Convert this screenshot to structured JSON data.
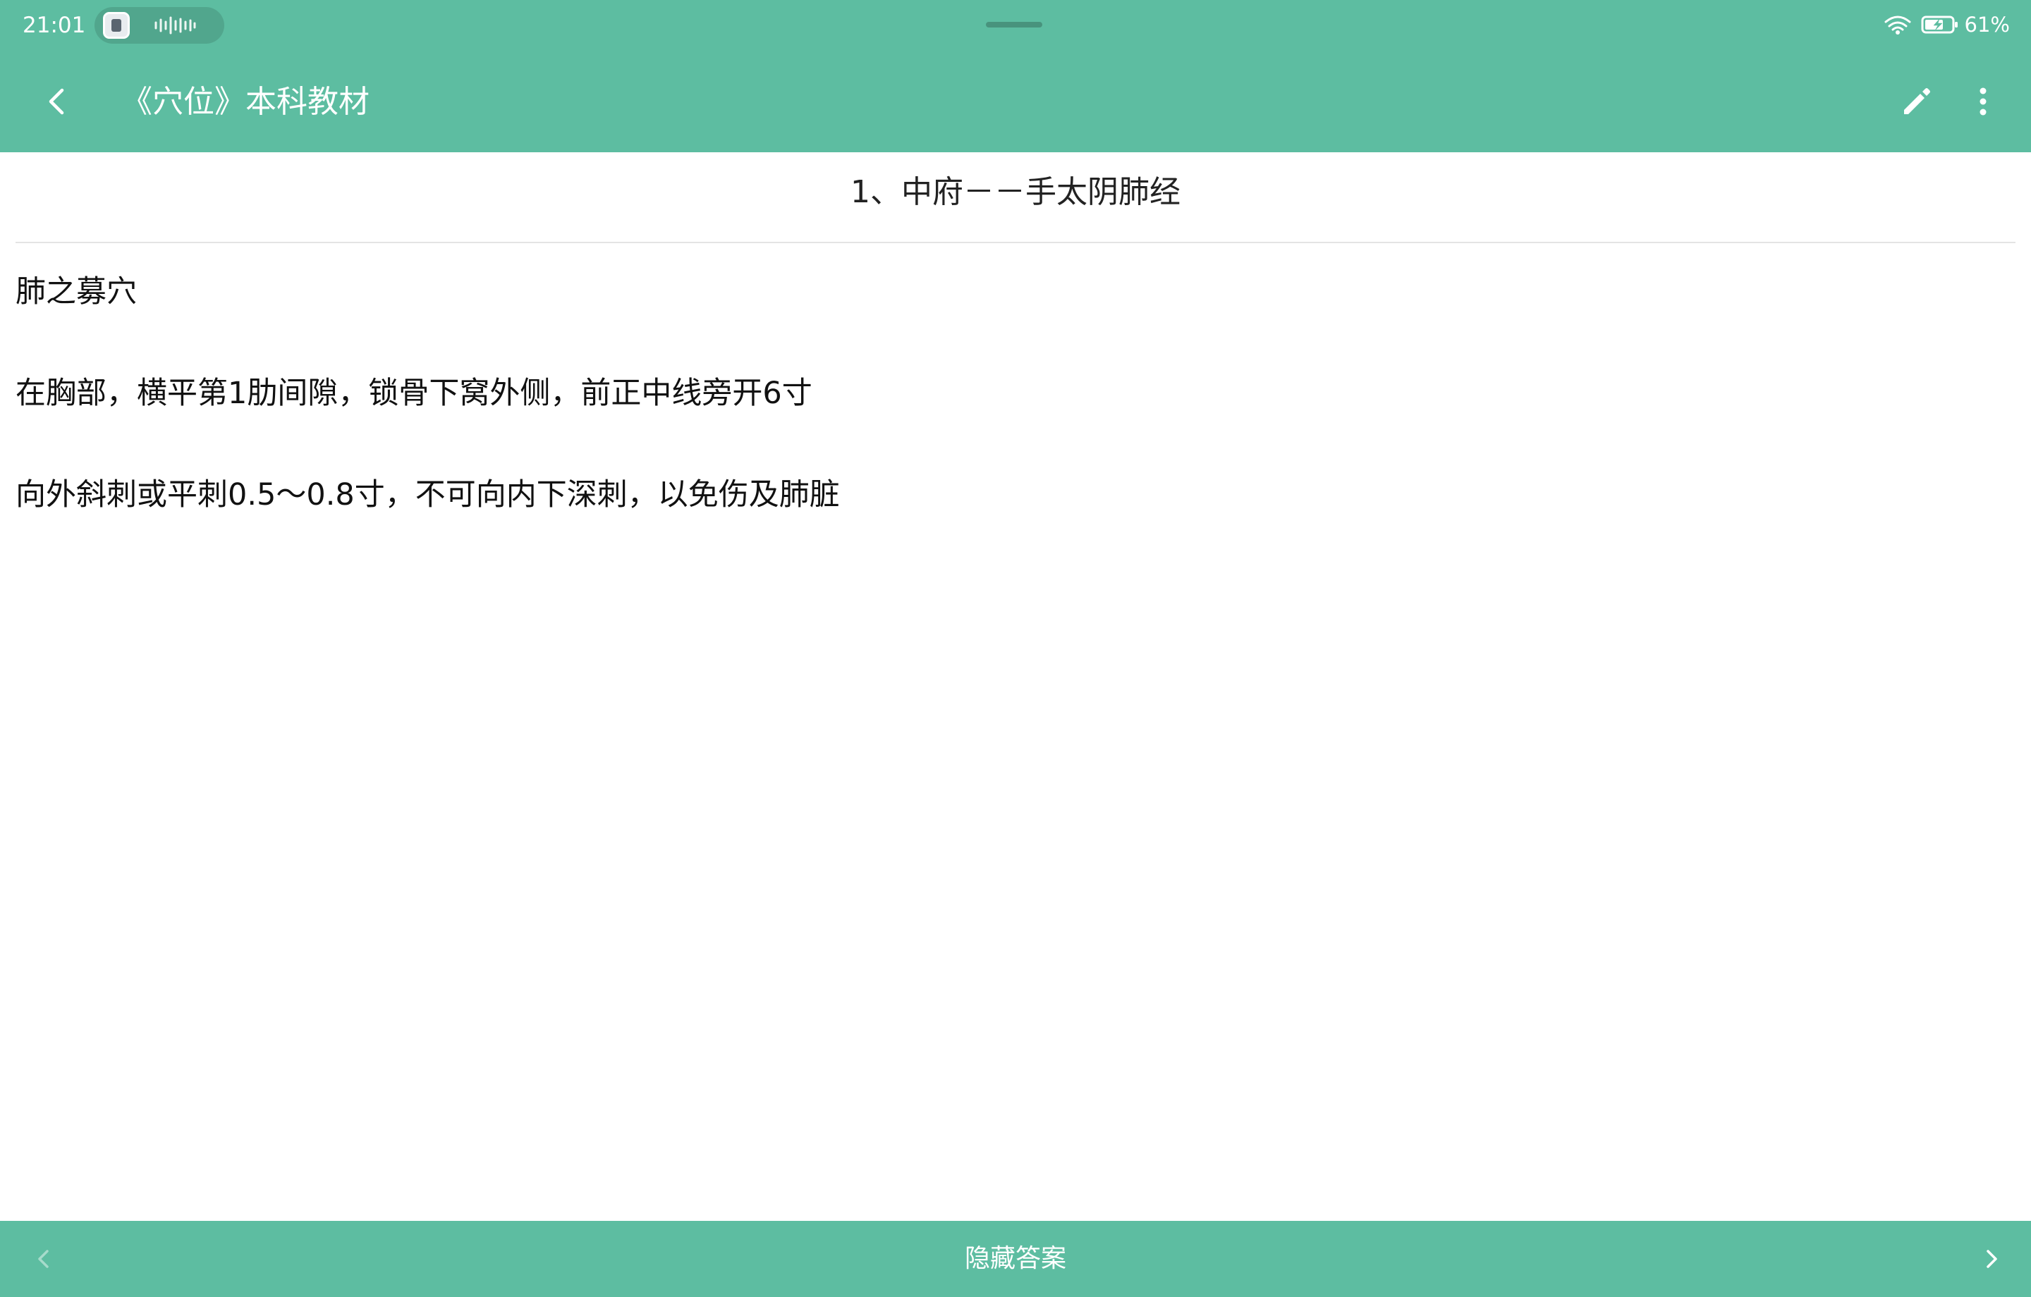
{
  "status_bar": {
    "time": "21:01",
    "battery_percent": "61%",
    "icons": [
      "app-indicator-icon",
      "audio-wave-icon",
      "wifi-icon",
      "battery-charging-icon"
    ]
  },
  "app_bar": {
    "title": "《穴位》本科教材",
    "icons": [
      "back-arrow-icon",
      "pencil-icon",
      "more-vertical-icon"
    ]
  },
  "card": {
    "title": "1、中府－－手太阴肺经",
    "answer_lines": [
      "肺之募穴",
      "在胸部，横平第1肋间隙，锁骨下窝外侧，前正中线旁开6寸",
      "向外斜刺或平刺0.5～0.8寸，不可向内下深刺，以免伤及肺脏"
    ]
  },
  "bottom_bar": {
    "hide_answer_label": "隐藏答案",
    "icons": [
      "chevron-left-icon",
      "chevron-right-icon"
    ]
  },
  "colors": {
    "primary": "#5dbda1",
    "text": "#111111",
    "background": "#ffffff"
  }
}
